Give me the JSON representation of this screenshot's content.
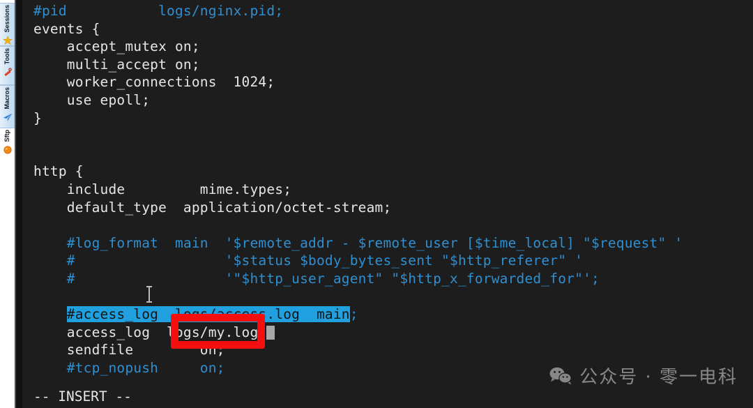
{
  "app": {
    "kind": "terminal-ssh-client",
    "background": "#1d1d1d",
    "accent_comment_color": "#2f8fd0",
    "selection_color": "#21a0e0",
    "annotation_color": "#f40f0f"
  },
  "sidebar": {
    "tabs": [
      {
        "label": "Sessions",
        "icon": "star-icon",
        "icon_color": "#f5b217",
        "active": false
      },
      {
        "label": "Tools",
        "icon": "wrench-icon",
        "icon_color": "#e0452c",
        "active": false
      },
      {
        "label": "Macros",
        "icon": "paper-plane-icon",
        "icon_color": "#2a7fd4",
        "active": false
      },
      {
        "label": "Sftp",
        "icon": "orange-dot-icon",
        "icon_color": "#f08a1a",
        "active": true
      }
    ]
  },
  "editor": {
    "mode_line": "-- INSERT --",
    "lines": [
      {
        "segments": [
          {
            "text": "#pid",
            "type": "comment"
          },
          {
            "text": "           ",
            "type": "plain"
          },
          {
            "text": "logs/nginx.pid;",
            "type": "comment"
          }
        ]
      },
      {
        "segments": [
          {
            "text": "events {",
            "type": "plain"
          }
        ]
      },
      {
        "segments": [
          {
            "text": "    accept_mutex on;",
            "type": "plain"
          }
        ]
      },
      {
        "segments": [
          {
            "text": "    multi_accept on;",
            "type": "plain"
          }
        ]
      },
      {
        "segments": [
          {
            "text": "    worker_connections  1024;",
            "type": "plain"
          }
        ]
      },
      {
        "segments": [
          {
            "text": "    use epoll;",
            "type": "plain"
          }
        ]
      },
      {
        "segments": [
          {
            "text": "}",
            "type": "plain"
          }
        ]
      },
      {
        "segments": [
          {
            "text": "",
            "type": "plain"
          }
        ]
      },
      {
        "segments": [
          {
            "text": "",
            "type": "plain"
          }
        ]
      },
      {
        "segments": [
          {
            "text": "http {",
            "type": "plain"
          }
        ]
      },
      {
        "segments": [
          {
            "text": "    include         mime.types;",
            "type": "plain"
          }
        ]
      },
      {
        "segments": [
          {
            "text": "    default_type  application/octet-stream;",
            "type": "plain"
          }
        ]
      },
      {
        "segments": [
          {
            "text": "",
            "type": "plain"
          }
        ]
      },
      {
        "segments": [
          {
            "text": "    #log_format  main  '$remote_addr - $remote_user [$time_local] \"$request\" '",
            "type": "comment"
          }
        ]
      },
      {
        "segments": [
          {
            "text": "    #                  '$status $body_bytes_sent \"$http_referer\" '",
            "type": "comment"
          }
        ]
      },
      {
        "segments": [
          {
            "text": "    #                  '\"$http_user_agent\" \"$http_x_forwarded_for\"';",
            "type": "comment"
          }
        ]
      },
      {
        "segments": [
          {
            "text": "",
            "type": "plain"
          }
        ]
      },
      {
        "segments": [
          {
            "text": "    ",
            "type": "plain"
          },
          {
            "text": "#access_log  logs/access.log  main",
            "type": "selected"
          },
          {
            "text": ";",
            "type": "comment"
          }
        ]
      },
      {
        "segments": [
          {
            "text": "    access_log  logs/my.log;",
            "type": "plain"
          },
          {
            "text": "",
            "type": "cursor"
          }
        ]
      },
      {
        "segments": [
          {
            "text": "    sendfile        on;",
            "type": "plain"
          }
        ]
      },
      {
        "segments": [
          {
            "text": "    #tcp_nopush     on;",
            "type": "comment"
          }
        ]
      }
    ]
  },
  "annotation": {
    "name": "red-highlight-box",
    "targets_text": "logs/my."
  },
  "watermark": {
    "text": "公众号 · 零一电科",
    "icon": "wechat-icon"
  }
}
